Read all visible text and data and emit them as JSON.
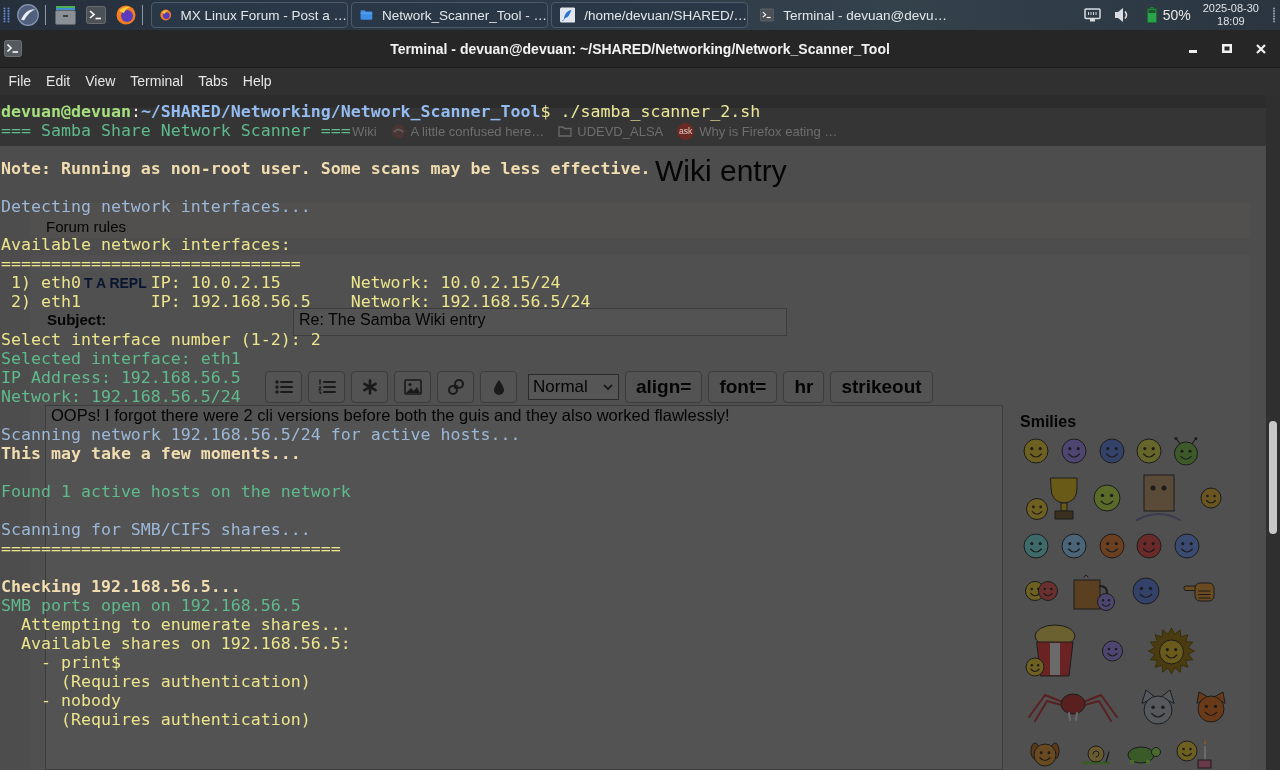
{
  "taskbar": {
    "tasks": [
      {
        "kind": "browser",
        "label": "MX Linux Forum - Post a …",
        "selected": false
      },
      {
        "kind": "files",
        "label": "Network_Scanner_Tool - …",
        "selected": false
      },
      {
        "kind": "editor",
        "label": "/home/devuan/SHARED/…",
        "selected": false
      },
      {
        "kind": "terminal",
        "label": "Terminal - devuan@devu…",
        "selected": true
      }
    ],
    "tray": {
      "battery": "50%",
      "date": "2025-08-30",
      "time": "18:09"
    }
  },
  "window": {
    "title": "Terminal - devuan@devuan: ~/SHARED/Networking/Network_Scanner_Tool"
  },
  "menu": [
    "File",
    "Edit",
    "View",
    "Terminal",
    "Tabs",
    "Help"
  ],
  "background_page": {
    "bookmarks": [
      {
        "kind": "page",
        "label": "Wiki"
      },
      {
        "kind": "forum",
        "label": "A little confused here…"
      },
      {
        "kind": "folder",
        "label": "UDEVD_ALSA"
      },
      {
        "kind": "site",
        "icon_text": "ask",
        "label": "Why is Firefox eating …"
      }
    ],
    "heading": "Wiki entry",
    "forum_rules": "Forum rules",
    "reply": {
      "title": "T A REPL",
      "subject_label": "Subject:",
      "subject": "Re: The Samba Wiki entry",
      "format": "Normal",
      "tag_buttons": [
        "align=",
        "font=",
        "hr",
        "strikeout"
      ],
      "message": "OOPs! I forgot there were 2 cli versions before both the guis and they also worked flawlessly!",
      "smilies_title": "Smilies"
    }
  },
  "terminal": {
    "blocks": [
      {
        "lines": [
          {
            "kind": "prompt",
            "user_host": "devuan@devuan",
            "separator": ":",
            "path": "~/SHARED/Networking/Network_Scanner_Tool",
            "symbol": "$",
            "command": "./samba_scanner_2.sh"
          },
          {
            "kind": "text",
            "text": "=== Samba Share Network Scanner ===",
            "color": "#5fba8c",
            "bold": false
          }
        ]
      },
      {
        "lines": [
          {
            "kind": "text",
            "text": "Note: Running as non-root user. Some scans may be less effective.",
            "color": "#f2ddb0",
            "bold": true
          }
        ]
      },
      {
        "lines": [
          {
            "kind": "text",
            "text": "Detecting network interfaces...",
            "color": "#9cb8d8",
            "bold": false
          }
        ]
      },
      {
        "lines": [
          {
            "kind": "text",
            "text": "Available network interfaces:",
            "color": "#ede58c",
            "bold": false
          },
          {
            "kind": "text",
            "text": "==============================",
            "color": "#ede58c",
            "bold": false
          },
          {
            "kind": "interface",
            "number": "1)",
            "name": "eth0",
            "ip": "IP: 10.0.2.15",
            "network": "Network: 10.0.2.15/24",
            "color": "#ede58c"
          },
          {
            "kind": "interface",
            "number": "2)",
            "name": "eth1",
            "ip": "IP: 192.168.56.5",
            "network": "Network: 192.168.56.5/24",
            "color": "#ede58c"
          }
        ]
      },
      {
        "lines": [
          {
            "kind": "text",
            "text": "Select interface number (1-2): 2",
            "color": "#ede58c",
            "bold": false
          },
          {
            "kind": "text",
            "text": "Selected interface: eth1",
            "color": "#5fba8c",
            "bold": false
          },
          {
            "kind": "text",
            "text": "IP Address: 192.168.56.5",
            "color": "#5fba8c",
            "bold": false
          },
          {
            "kind": "text",
            "text": "Network: 192.168.56.5/24",
            "color": "#5fba8c",
            "bold": false
          }
        ]
      },
      {
        "lines": [
          {
            "kind": "text",
            "text": "Scanning network 192.168.56.5/24 for active hosts...",
            "color": "#9cb8d8",
            "bold": false
          },
          {
            "kind": "text",
            "text": "This may take a few moments...",
            "color": "#f2ddb0",
            "bold": true
          }
        ]
      },
      {
        "lines": [
          {
            "kind": "text",
            "text": "Found 1 active hosts on the network",
            "color": "#5fba8c",
            "bold": false
          }
        ]
      },
      {
        "lines": [
          {
            "kind": "text",
            "text": "Scanning for SMB/CIFS shares...",
            "color": "#9cb8d8",
            "bold": false
          },
          {
            "kind": "text",
            "text": "==================================",
            "color": "#ede58c",
            "bold": false
          }
        ]
      },
      {
        "lines": [
          {
            "kind": "text",
            "text": "Checking 192.168.56.5...",
            "color": "#f2ddb0",
            "bold": true
          },
          {
            "kind": "text",
            "text": "SMB ports open on 192.168.56.5",
            "color": "#5fba8c",
            "bold": false,
            "children": [
              {
                "kind": "text",
                "text": "Attempting to enumerate shares...",
                "color": "#ede58c",
                "bold": false
              },
              {
                "kind": "text",
                "text": "Available shares on 192.168.56.5:",
                "color": "#ede58c",
                "bold": false,
                "children": [
                  {
                    "kind": "text",
                    "text": "- print$",
                    "color": "#ede58c",
                    "bold": false,
                    "children": [
                      {
                        "kind": "text",
                        "text": "(Requires authentication)",
                        "color": "#ede58c",
                        "bold": false
                      }
                    ]
                  },
                  {
                    "kind": "text",
                    "text": "- nobody",
                    "color": "#ede58c",
                    "bold": false,
                    "children": [
                      {
                        "kind": "text",
                        "text": "(Requires authentication)",
                        "color": "#ede58c",
                        "bold": false
                      }
                    ]
                  }
                ]
              }
            ]
          }
        ]
      }
    ]
  }
}
